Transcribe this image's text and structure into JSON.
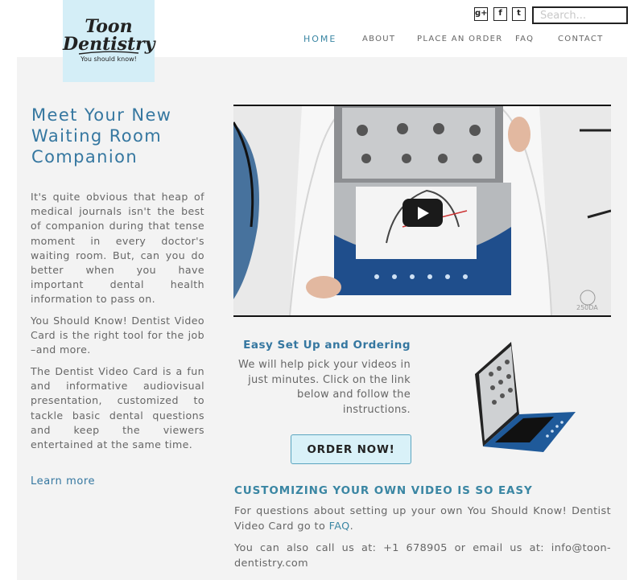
{
  "brand": {
    "name_line1": "Toon",
    "name_line2": "Dentistry",
    "tagline": "You should know!",
    "accent_color": "#3577a0",
    "logo_bg_color": "#d4eef7"
  },
  "social": [
    {
      "icon": "google-plus-icon",
      "glyph": "g+"
    },
    {
      "icon": "facebook-icon",
      "glyph": "f"
    },
    {
      "icon": "twitter-icon",
      "glyph": "t"
    }
  ],
  "search": {
    "placeholder": "Search..."
  },
  "nav": {
    "home": "HOME",
    "about": "ABOUT",
    "order": "PLACE AN ORDER",
    "faq": "FAQ",
    "contact": "CONTACT"
  },
  "hero": {
    "title": "Meet Your New Waiting Room Companion",
    "p1": "It's quite obvious that heap of medical journals isn't the best of companion during that tense moment in every doctor's waiting room. But, can you do better when you have important dental health information to pass on.",
    "p2": "You Should Know! Dentist Video Card is the right tool for the job –and more.",
    "p3": "The Dentist Video Card is a fun and informative audiovisual presentation, customized to tackle basic dental questions and keep the viewers entertained at the same time.",
    "learn_more": "Learn more"
  },
  "video": {
    "watermark": "250DA",
    "play_icon": "play-icon"
  },
  "setup": {
    "title": "Easy Set Up and Ordering",
    "text": "We will help pick your videos in just minutes. Click on the link below and follow the instructions.",
    "order_button": "ORDER NOW!"
  },
  "customize": {
    "title": "CUSTOMIZING YOUR OWN VIDEO IS SO EASY",
    "p1_text": "For questions about setting up your own You Should Know! Dentist Video Card go to",
    "p1_link": "FAQ",
    "p1_end": ".",
    "p2": "You can also call us at: +1 678905 or email us at: info@toon-dentistry.com"
  }
}
